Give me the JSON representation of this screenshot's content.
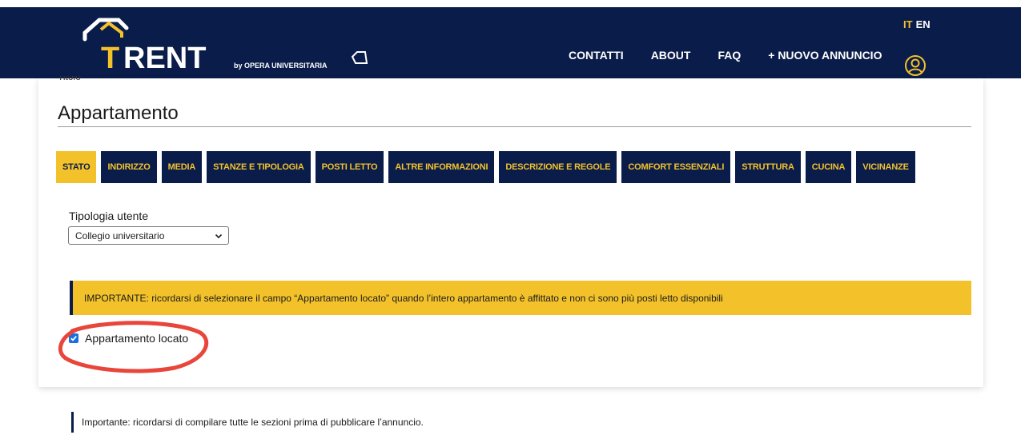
{
  "header": {
    "logo_text": "TRENT",
    "logo_byline": "by OPERA UNIVERSITARIA",
    "nav": [
      {
        "label": "CONTATTI"
      },
      {
        "label": "ABOUT"
      },
      {
        "label": "FAQ"
      },
      {
        "label": "+ NUOVO ANNUNCIO"
      }
    ],
    "lang_it": "IT",
    "lang_en": "EN",
    "user_icon": "user-circle-icon"
  },
  "form": {
    "cut_label": "Titolo",
    "title": "Appartamento",
    "tabs": [
      {
        "label": "STATO",
        "active": true
      },
      {
        "label": "INDIRIZZO"
      },
      {
        "label": "MEDIA"
      },
      {
        "label": "STANZE E TIPOLOGIA"
      },
      {
        "label": "POSTI LETTO"
      },
      {
        "label": "ALTRE INFORMAZIONI"
      },
      {
        "label": "DESCRIZIONE E REGOLE"
      },
      {
        "label": "COMFORT ESSENZIALI"
      },
      {
        "label": "STRUTTURA"
      },
      {
        "label": "CUCINA"
      },
      {
        "label": "VICINANZE"
      }
    ],
    "user_type_label": "Tipologia utente",
    "user_type_value": "Collegio universitario",
    "alert_text": "IMPORTANTE: ricordarsi di selezionare il campo “Appartamento locato” quando l’intero appartamento è affittato e non ci sono più posti letto disponibili",
    "checkbox_label": "Appartamento locato",
    "checkbox_checked": true
  },
  "footer_note": "Importante: ricordarsi di compilare tutte le sezioni prima di pubblicare l’annuncio.",
  "colors": {
    "navy": "#0a1c4a",
    "yellow": "#f3c22b",
    "highlight_red": "#e8463a"
  }
}
